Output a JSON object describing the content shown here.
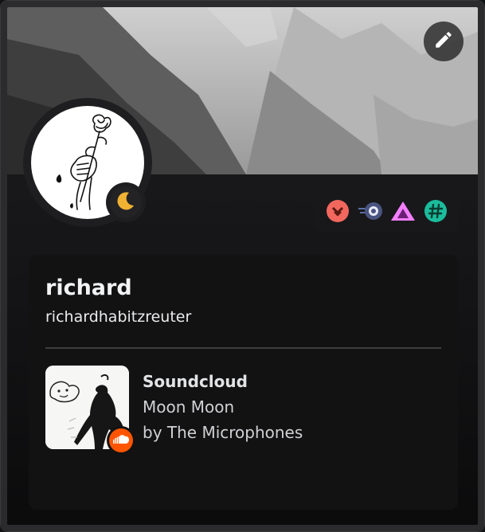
{
  "profile": {
    "display_name": "richard",
    "username": "richardhabitzreuter",
    "status": "idle",
    "avatar_icon": "rose-hand-drawing"
  },
  "header": {
    "edit_icon": "pencil-icon"
  },
  "badges": [
    {
      "icon": "chevron-badge-icon",
      "color": "#f2675e"
    },
    {
      "icon": "orbit-badge-icon",
      "color": "#7d88b8"
    },
    {
      "icon": "triangle-badge-icon",
      "color": "#f47fff"
    },
    {
      "icon": "hashtag-badge-icon",
      "color": "#23a559"
    }
  ],
  "activity": {
    "title": "Soundcloud",
    "song": "Moon Moon",
    "artist": "by The Microphones",
    "app_icon": "soundcloud-icon",
    "app_color": "#ff5500"
  }
}
